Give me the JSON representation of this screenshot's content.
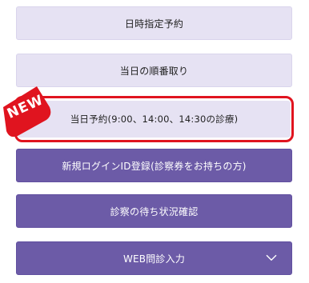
{
  "menu": {
    "date_reservation": "日時指定予約",
    "same_day_queue": "当日の順番取り",
    "same_day_reservation": "当日予約(9:00、14:00、14:30の診療)",
    "new_login_registration": "新規ログインID登録(診察券をお持ちの方)",
    "wait_status": "診察の待ち状況確認",
    "web_questionnaire": "WEB問診入力"
  },
  "badge": {
    "label": "NEW"
  },
  "icons": {
    "expand": "chevron-down-icon"
  },
  "colors": {
    "light_button": "#e6e2f3",
    "dark_button": "#6c5ba7",
    "highlight_border": "#e0141f",
    "badge": "#e0141f"
  }
}
